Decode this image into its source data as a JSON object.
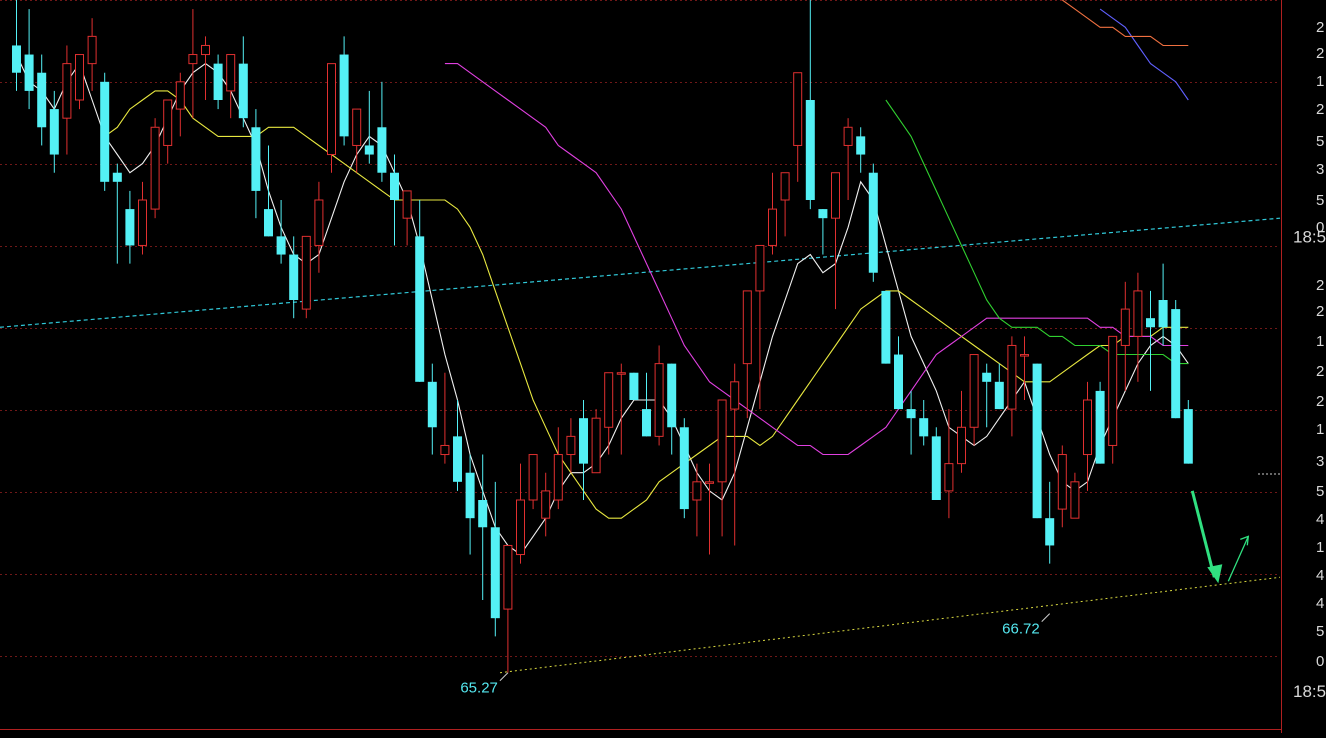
{
  "chart_data": {
    "type": "candlestick",
    "colors": {
      "background": "#000000",
      "up": "#e03030",
      "down": "#54f0f5",
      "ma5": "#f0f0f0",
      "ma10": "#e8e840",
      "ma20": "#e040e0",
      "ma60": "#30d030",
      "ma120": "#6060ff",
      "ma250": "#f07040",
      "grid": "#701818",
      "trend_upper": "#30c8d8",
      "trend_lower": "#d8d840",
      "arrow": "#30e080",
      "axis_text": "#d8d8d8",
      "low_label": "#55e8f0"
    },
    "y_range": [
      64.6,
      72.3
    ],
    "candles": [
      [
        71.8,
        72.3,
        71.3,
        71.5
      ],
      [
        71.7,
        72.2,
        71.1,
        71.3
      ],
      [
        71.5,
        71.7,
        70.7,
        70.9
      ],
      [
        71.1,
        71.3,
        70.4,
        70.6
      ],
      [
        71.0,
        71.8,
        70.6,
        71.6
      ],
      [
        71.2,
        71.6,
        71.1,
        71.7
      ],
      [
        71.6,
        72.1,
        71.3,
        71.9
      ],
      [
        71.4,
        71.5,
        70.2,
        70.3
      ],
      [
        70.4,
        70.5,
        69.4,
        70.3
      ],
      [
        70.0,
        70.2,
        69.4,
        69.6
      ],
      [
        69.6,
        70.3,
        69.5,
        70.1
      ],
      [
        70.0,
        71.0,
        69.9,
        70.9
      ],
      [
        70.7,
        71.2,
        70.5,
        71.2
      ],
      [
        71.1,
        71.5,
        70.8,
        71.4
      ],
      [
        71.6,
        72.2,
        71.0,
        71.7
      ],
      [
        71.7,
        71.9,
        71.2,
        71.8
      ],
      [
        71.6,
        71.7,
        71.1,
        71.2
      ],
      [
        71.3,
        71.6,
        71.0,
        71.7
      ],
      [
        71.6,
        71.9,
        70.9,
        71.0
      ],
      [
        70.9,
        71.1,
        69.9,
        70.2
      ],
      [
        70.0,
        70.7,
        69.8,
        69.7
      ],
      [
        69.7,
        70.1,
        69.4,
        69.5
      ],
      [
        69.5,
        69.7,
        68.8,
        69.0
      ],
      [
        68.9,
        69.7,
        68.8,
        69.7
      ],
      [
        69.6,
        70.3,
        69.3,
        70.1
      ],
      [
        70.6,
        71.4,
        70.4,
        71.6
      ],
      [
        71.7,
        71.9,
        70.7,
        70.8
      ],
      [
        70.7,
        71.0,
        70.4,
        71.1
      ],
      [
        70.7,
        71.3,
        70.5,
        70.6
      ],
      [
        70.9,
        71.4,
        70.3,
        70.4
      ],
      [
        70.4,
        70.6,
        69.6,
        70.1
      ],
      [
        69.9,
        70.0,
        69.6,
        70.2
      ],
      [
        69.7,
        70.1,
        68.9,
        68.1
      ],
      [
        68.1,
        68.3,
        67.3,
        67.6
      ],
      [
        67.3,
        68.2,
        67.2,
        67.4
      ],
      [
        67.5,
        67.9,
        66.9,
        67.0
      ],
      [
        67.1,
        67.3,
        66.2,
        66.6
      ],
      [
        66.8,
        67.3,
        65.7,
        66.5
      ],
      [
        66.5,
        67.0,
        65.3,
        65.5
      ],
      [
        65.6,
        65.9,
        64.9,
        66.3
      ],
      [
        66.2,
        67.2,
        66.1,
        66.8
      ],
      [
        66.8,
        67.3,
        66.7,
        67.3
      ],
      [
        66.6,
        67.1,
        66.4,
        66.9
      ],
      [
        66.8,
        67.6,
        66.7,
        67.3
      ],
      [
        67.3,
        67.7,
        67.1,
        67.5
      ],
      [
        67.7,
        67.9,
        66.8,
        67.2
      ],
      [
        67.1,
        67.8,
        67.1,
        67.7
      ],
      [
        67.6,
        68.1,
        67.3,
        68.2
      ],
      [
        68.2,
        68.3,
        67.3,
        68.2
      ],
      [
        68.2,
        68.1,
        67.9,
        67.9
      ],
      [
        67.8,
        68.2,
        67.5,
        67.5
      ],
      [
        67.5,
        68.5,
        67.4,
        68.3
      ],
      [
        68.3,
        68.3,
        67.3,
        67.6
      ],
      [
        67.6,
        67.7,
        66.6,
        66.7
      ],
      [
        66.8,
        67.2,
        66.4,
        67.0
      ],
      [
        67.0,
        67.2,
        66.2,
        67.0
      ],
      [
        67.0,
        67.6,
        66.4,
        67.9
      ],
      [
        67.8,
        68.3,
        66.3,
        68.1
      ],
      [
        68.3,
        69.0,
        67.7,
        69.1
      ],
      [
        69.1,
        69.4,
        67.8,
        69.6
      ],
      [
        69.6,
        70.4,
        69.5,
        70.0
      ],
      [
        70.1,
        70.3,
        69.7,
        70.4
      ],
      [
        70.7,
        71.5,
        70.3,
        71.5
      ],
      [
        71.2,
        72.3,
        70.0,
        70.1
      ],
      [
        70.0,
        69.8,
        69.5,
        69.9
      ],
      [
        69.9,
        70.1,
        68.9,
        70.4
      ],
      [
        70.7,
        71.0,
        70.1,
        70.9
      ],
      [
        70.8,
        70.9,
        70.4,
        70.6
      ],
      [
        70.4,
        70.5,
        69.2,
        69.3
      ],
      [
        69.1,
        69.1,
        68.3,
        68.3
      ],
      [
        68.4,
        68.6,
        67.8,
        67.8
      ],
      [
        67.8,
        68.0,
        67.3,
        67.7
      ],
      [
        67.7,
        67.9,
        67.4,
        67.5
      ],
      [
        67.5,
        67.6,
        66.8,
        66.8
      ],
      [
        66.9,
        67.8,
        66.6,
        67.2
      ],
      [
        67.2,
        68.0,
        67.1,
        67.6
      ],
      [
        67.6,
        68.1,
        67.4,
        68.4
      ],
      [
        68.2,
        68.3,
        67.6,
        68.1
      ],
      [
        68.1,
        68.3,
        67.9,
        67.8
      ],
      [
        67.8,
        68.6,
        67.5,
        68.5
      ],
      [
        68.4,
        68.6,
        67.9,
        68.4
      ],
      [
        68.3,
        68.3,
        66.8,
        66.6
      ],
      [
        66.6,
        67.0,
        66.1,
        66.3
      ],
      [
        66.7,
        67.4,
        66.5,
        67.3
      ],
      [
        66.6,
        67.1,
        66.9,
        67.0
      ],
      [
        67.3,
        68.1,
        66.9,
        67.9
      ],
      [
        68.0,
        68.1,
        67.5,
        67.2
      ],
      [
        67.4,
        68.3,
        67.2,
        68.6
      ],
      [
        68.5,
        69.2,
        68.0,
        68.9
      ],
      [
        68.6,
        69.3,
        68.1,
        69.1
      ],
      [
        68.8,
        69.1,
        68.0,
        68.7
      ],
      [
        69.0,
        69.4,
        68.5,
        68.7
      ],
      [
        68.9,
        69.0,
        67.9,
        67.7
      ],
      [
        67.8,
        67.9,
        67.2,
        67.2
      ]
    ],
    "ma_series": [
      {
        "key": "ma5",
        "values": [
          71.7,
          71.4,
          71.3,
          71.1,
          71.4,
          71.6,
          71.2,
          70.8,
          70.6,
          70.4,
          70.5,
          70.7,
          71.0,
          71.3,
          71.5,
          71.6,
          71.5,
          71.3,
          71.0,
          70.7,
          70.2,
          69.8,
          69.5,
          69.4,
          69.5,
          69.9,
          70.3,
          70.6,
          70.8,
          70.7,
          70.4,
          70.1,
          69.6,
          69.0,
          68.4,
          67.9,
          67.3,
          66.9,
          66.5,
          66.3,
          66.2,
          66.4,
          66.6,
          66.9,
          67.1,
          67.1,
          67.2,
          67.4,
          67.7,
          67.9,
          67.9,
          67.9,
          67.7,
          67.4,
          67.1,
          66.9,
          66.8,
          67.1,
          67.6,
          68.1,
          68.6,
          69.0,
          69.4,
          69.5,
          69.3,
          69.4,
          69.8,
          70.3,
          70.1,
          69.6,
          69.1,
          68.6,
          68.3,
          68.0,
          67.6,
          67.5,
          67.4,
          67.5,
          67.7,
          67.9,
          68.1,
          67.7,
          67.3,
          67.0,
          66.9,
          67.0,
          67.4,
          67.7,
          68.0,
          68.3,
          68.5,
          68.6,
          68.5,
          68.3
        ]
      },
      {
        "key": "ma10",
        "values": [
          70.8,
          70.9,
          71.1,
          71.2,
          71.3,
          71.3,
          71.2,
          71.0,
          70.9,
          70.8,
          70.8,
          70.8,
          70.8,
          70.9,
          70.9,
          70.9,
          70.8,
          70.7,
          70.6,
          70.5,
          70.4,
          70.3,
          70.2,
          70.1,
          70.1,
          70.1,
          70.1,
          70.1,
          70.0,
          69.8,
          69.5,
          69.1,
          68.7,
          68.3,
          67.9,
          67.6,
          67.3,
          67.1,
          66.9,
          66.7,
          66.6,
          66.6,
          66.7,
          66.8,
          67.0,
          67.1,
          67.2,
          67.3,
          67.4,
          67.5,
          67.5,
          67.5,
          67.4,
          67.5,
          67.7,
          67.9,
          68.1,
          68.3,
          68.5,
          68.7,
          68.9,
          69.0,
          69.1,
          69.1,
          69.0,
          68.9,
          68.8,
          68.7,
          68.6,
          68.5,
          68.4,
          68.3,
          68.2,
          68.1,
          68.1,
          68.1,
          68.2,
          68.3,
          68.4,
          68.5,
          68.5,
          68.6,
          68.6,
          68.6,
          68.7,
          68.7,
          68.7
        ]
      },
      {
        "key": "ma20",
        "values": [
          71.6,
          71.6,
          71.5,
          71.4,
          71.3,
          71.2,
          71.1,
          71.0,
          70.9,
          70.7,
          70.6,
          70.5,
          70.4,
          70.2,
          70.0,
          69.7,
          69.4,
          69.1,
          68.8,
          68.5,
          68.3,
          68.1,
          68.0,
          67.9,
          67.8,
          67.7,
          67.6,
          67.5,
          67.4,
          67.4,
          67.3,
          67.3,
          67.3,
          67.4,
          67.5,
          67.6,
          67.8,
          68.0,
          68.2,
          68.4,
          68.5,
          68.6,
          68.7,
          68.8,
          68.8,
          68.8,
          68.8,
          68.8,
          68.8,
          68.8,
          68.8,
          68.8,
          68.7,
          68.7,
          68.6,
          68.6,
          68.6,
          68.5,
          68.5,
          68.5
        ]
      },
      {
        "key": "ma60",
        "values": [
          71.2,
          71.0,
          70.8,
          70.5,
          70.2,
          69.9,
          69.6,
          69.3,
          69.0,
          68.8,
          68.7,
          68.7,
          68.7,
          68.6,
          68.6,
          68.5,
          68.5,
          68.5,
          68.4,
          68.4,
          68.4,
          68.4,
          68.4,
          68.3,
          68.3
        ]
      },
      {
        "key": "ma120",
        "values": [
          72.2,
          72.1,
          72.0,
          71.8,
          71.6,
          71.5,
          71.4,
          71.2
        ]
      },
      {
        "key": "ma250",
        "values": [
          72.3,
          72.2,
          72.1,
          72.0,
          72.0,
          71.9,
          71.9,
          71.9,
          71.8,
          71.8,
          71.8
        ]
      }
    ],
    "annotations": [
      {
        "text": "65.27",
        "price": 64.9
      },
      {
        "text": "66.72",
        "price": 65.55
      }
    ],
    "axis_labels": [
      {
        "text": "18:5",
        "price": 69.7
      },
      {
        "text": "18:5",
        "price": 64.7
      }
    ],
    "axis_fragments": [
      "2",
      "2",
      "1",
      "2",
      "5",
      "3",
      "5",
      "0",
      "2",
      "2",
      "1",
      "2",
      "2",
      "1",
      "3",
      "5",
      "4",
      "1",
      "4",
      "4",
      "5",
      "0"
    ]
  }
}
